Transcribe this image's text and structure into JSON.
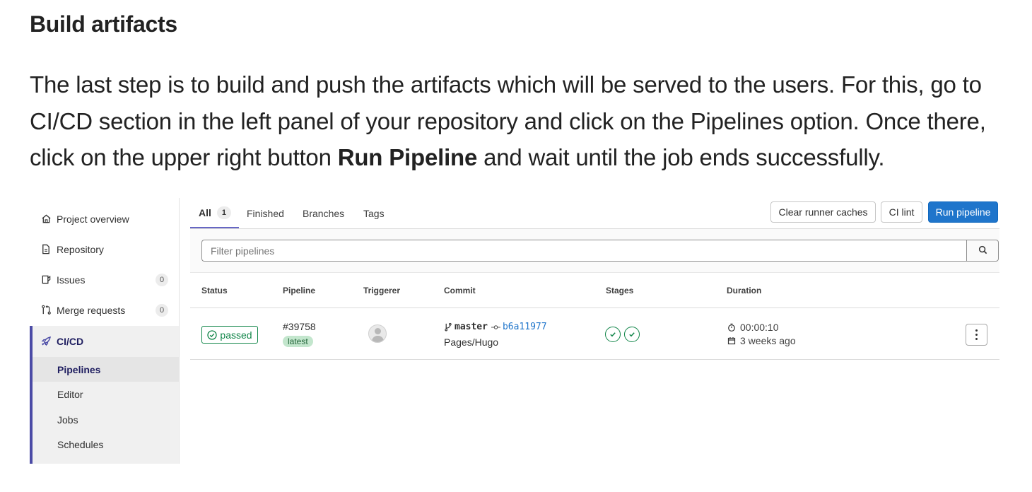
{
  "article": {
    "title": "Build artifacts",
    "para_before": "The last step is to build and push the artifacts which will be served to the users. For this, go to CI/CD section in the left panel of your repository and click on the Pipelines option. Once there, click on the upper right button ",
    "para_bold": "Run Pipeline",
    "para_after": " and wait until the job ends successfully."
  },
  "sidebar": {
    "items": [
      {
        "label": "Project overview",
        "icon": "home-icon"
      },
      {
        "label": "Repository",
        "icon": "doc-icon"
      },
      {
        "label": "Issues",
        "icon": "issues-icon",
        "count": "0"
      },
      {
        "label": "Merge requests",
        "icon": "merge-request-icon",
        "count": "0"
      },
      {
        "label": "CI/CD",
        "icon": "rocket-icon"
      }
    ],
    "subitems": [
      "Pipelines",
      "Editor",
      "Jobs",
      "Schedules"
    ],
    "active_color": "#4b4ba6"
  },
  "tabs": {
    "all": "All",
    "all_count": "1",
    "finished": "Finished",
    "branches": "Branches",
    "tags": "Tags"
  },
  "toolbar": {
    "clear_caches": "Clear runner caches",
    "ci_lint": "CI lint",
    "run_pipeline": "Run pipeline",
    "primary_color": "#1f75cb"
  },
  "filter": {
    "placeholder": "Filter pipelines"
  },
  "table": {
    "headers": [
      "Status",
      "Pipeline",
      "Triggerer",
      "Commit",
      "Stages",
      "Duration"
    ],
    "row": {
      "status": "passed",
      "pipeline_id": "#39758",
      "tag": "latest",
      "branch": "master",
      "sha": "b6a11977",
      "commit_title": "Pages/Hugo",
      "duration": "00:00:10",
      "finished": "3 weeks ago",
      "status_color": "#108548"
    }
  }
}
